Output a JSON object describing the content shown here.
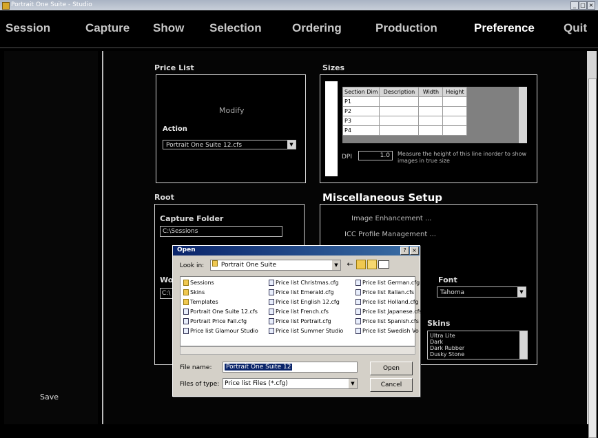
{
  "window": {
    "title": "Portrait One Suite - Studio"
  },
  "menu": {
    "items": [
      "Session",
      "Capture",
      "Show",
      "Selection",
      "Ordering",
      "Production",
      "Preference",
      "Quit"
    ]
  },
  "left": {
    "save": "Save"
  },
  "price_list": {
    "title": "Price List",
    "modify": "Modify",
    "action_label": "Action",
    "action_value": "Portrait One Suite 12.cfs"
  },
  "sizes": {
    "title": "Sizes",
    "headers": [
      "Section Dim",
      "Description",
      "Width",
      "Height"
    ],
    "rows": [
      "P1",
      "P2",
      "P3",
      "P4"
    ],
    "dpi_label": "DPI",
    "dpi_value": "1.0",
    "hint": "Measure the height of this line inorder to show images in true size"
  },
  "root": {
    "title": "Root",
    "capture_label": "Capture Folder",
    "capture_value": "C:\\Sessions",
    "w_label": "Wo",
    "w_value": "C:\\"
  },
  "misc": {
    "title": "Miscellaneous Setup",
    "link1": "Image Enhancement ...",
    "link2": "ICC Profile Management ...",
    "font_label": "Font",
    "font_value": "Tahoma",
    "skins_label": "Skins",
    "skins": [
      "Ultra Lite",
      "Dark",
      "Dark Rubber",
      "Dusky Stone"
    ]
  },
  "dialog": {
    "title": "Open",
    "lookin_label": "Look in:",
    "lookin_value": "Portrait One Suite",
    "files": [
      {
        "name": "Sessions",
        "type": "folder"
      },
      {
        "name": "Skins",
        "type": "folder"
      },
      {
        "name": "Templates",
        "type": "folder"
      },
      {
        "name": "Portrait One Suite 12.cfs",
        "type": "doc"
      },
      {
        "name": "Portrait Price Fall.cfg",
        "type": "doc"
      },
      {
        "name": "Price list Glamour Studio",
        "type": "doc"
      },
      {
        "name": "Price list Christmas.cfg",
        "type": "doc"
      },
      {
        "name": "Price list Emerald.cfg",
        "type": "doc"
      },
      {
        "name": "Price list English 12.cfg",
        "type": "doc"
      },
      {
        "name": "Price list French.cfs",
        "type": "doc"
      },
      {
        "name": "Price list Portrait.cfg",
        "type": "doc"
      },
      {
        "name": "Price list Summer Studio",
        "type": "doc"
      },
      {
        "name": "Price list German.cfg",
        "type": "doc"
      },
      {
        "name": "Price list Italian.cfs",
        "type": "doc"
      },
      {
        "name": "Price list Holland.cfg",
        "type": "doc"
      },
      {
        "name": "Price list Japanese.cfs",
        "type": "doc"
      },
      {
        "name": "Price list Spanish.cfs",
        "type": "doc"
      },
      {
        "name": "Price list Swedish Vo",
        "type": "doc"
      }
    ],
    "filename_label": "File name:",
    "filename_value": "Portrait One Suite 12",
    "filetype_label": "Files of type:",
    "filetype_value": "Price list Files (*.cfg)",
    "open_btn": "Open",
    "cancel_btn": "Cancel"
  }
}
